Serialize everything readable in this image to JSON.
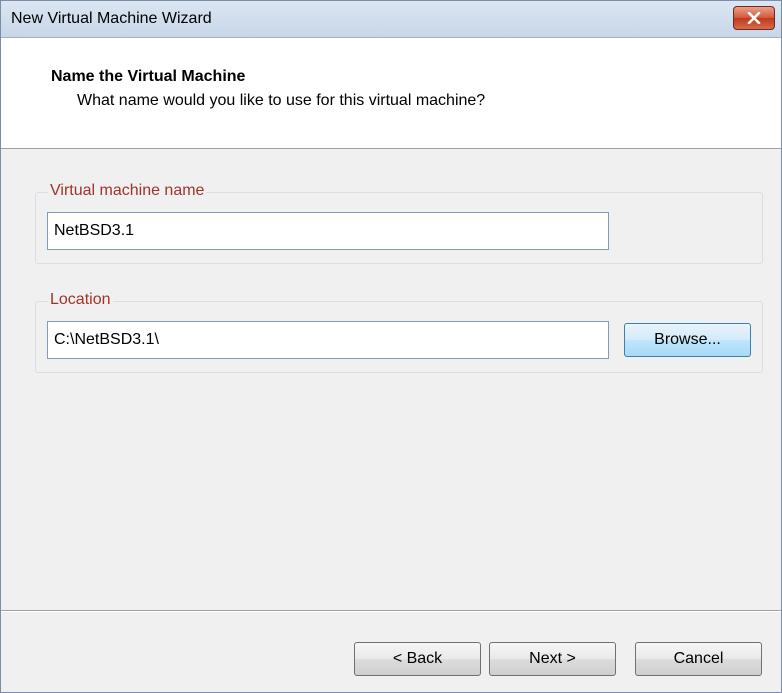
{
  "window": {
    "title": "New Virtual Machine Wizard"
  },
  "header": {
    "title": "Name the Virtual Machine",
    "subtitle": "What name would you like to use for this virtual machine?"
  },
  "vm_name_group": {
    "label": "Virtual machine name",
    "value": "NetBSD3.1"
  },
  "location_group": {
    "label": "Location",
    "value": "C:\\NetBSD3.1\\",
    "browse_label": "Browse..."
  },
  "buttons": {
    "back_label": "< Back",
    "next_label": "Next >",
    "cancel_label": "Cancel"
  },
  "icons": {
    "close": "close-icon"
  },
  "colors": {
    "group_label": "#a0332a",
    "close_button": "#c1391b"
  }
}
